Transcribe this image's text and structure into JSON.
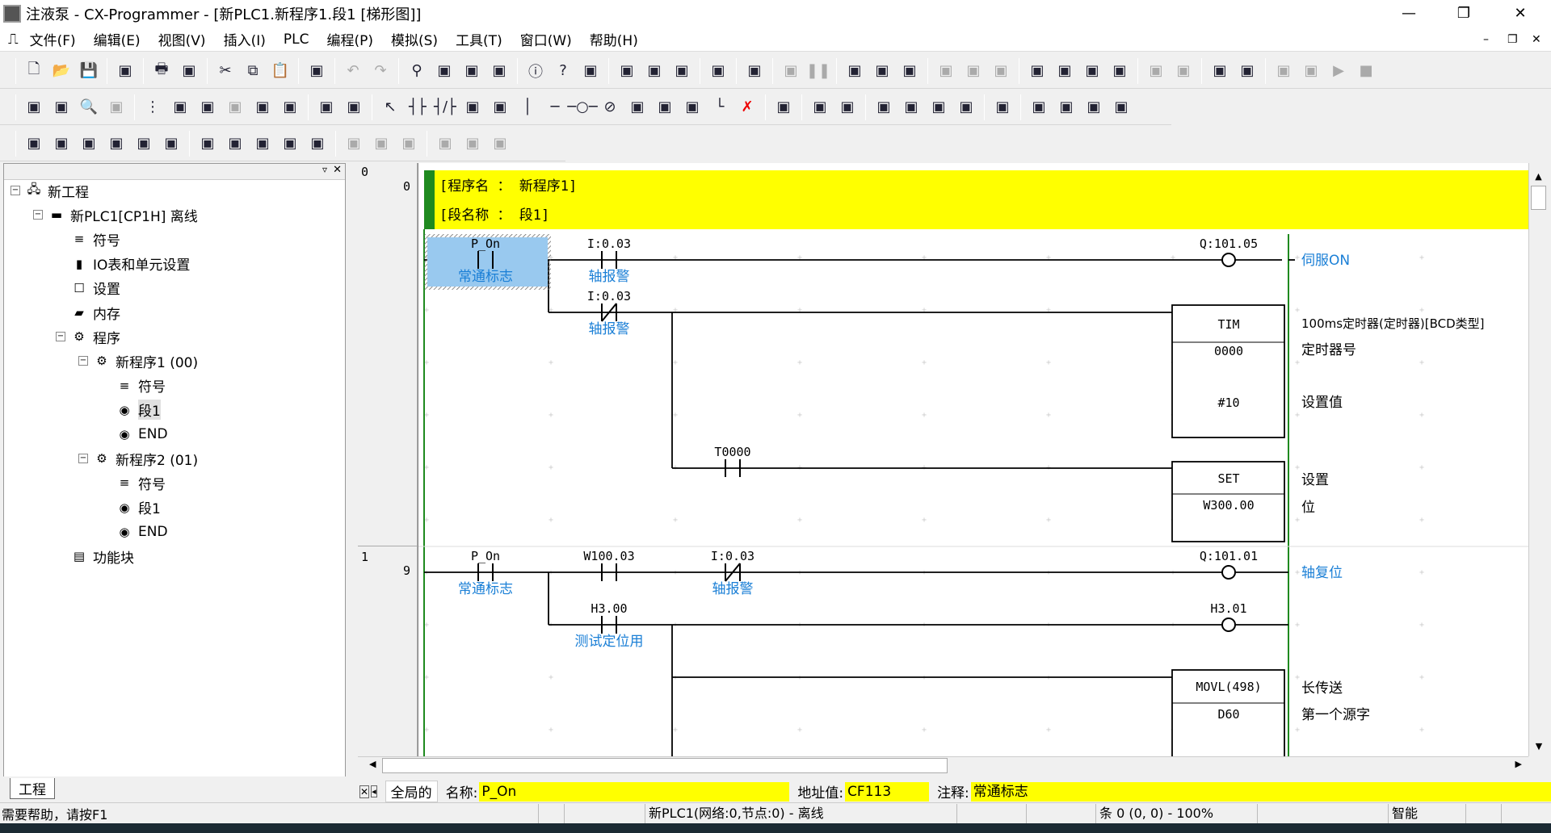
{
  "window": {
    "title": "注液泵 - CX-Programmer - [新PLC1.新程序1.段1 [梯形图]]",
    "minimize": "—",
    "restore": "❐",
    "close": "✕"
  },
  "menu": [
    "文件(F)",
    "编辑(E)",
    "视图(V)",
    "插入(I)",
    "PLC",
    "编程(P)",
    "模拟(S)",
    "工具(T)",
    "窗口(W)",
    "帮助(H)"
  ],
  "mdi_controls": [
    "–",
    "❐",
    "✕"
  ],
  "toolbars": {
    "row1": [
      "new-icon",
      "open-icon",
      "save-icon",
      "|",
      "print-preview-icon",
      "|",
      "print-icon",
      "preview-icon",
      "|",
      "cut-icon",
      "copy-icon",
      "paste-icon",
      "|",
      "paste-special-icon",
      "|",
      "undo-icon",
      "redo-icon",
      "|",
      "find-icon",
      "replace-icon",
      "cross-ref-icon",
      "address-ref-icon",
      "|",
      "info-icon",
      "help-icon",
      "context-help-icon",
      "|",
      "online-icon",
      "monitor-icon",
      "transfer-icon",
      "|",
      "compile-icon",
      "|",
      "compare-icon",
      "|",
      "step-icon",
      "pause-icon",
      "|",
      "io-table-icon",
      "setup-icon",
      "memory-icon",
      "|",
      "force-icon",
      "force-off-icon",
      "force-cancel-icon",
      "|",
      "set-icon",
      "reset-icon",
      "data-trace-icon",
      "time-chart-icon",
      "|",
      "sim-icon",
      "sim2-icon",
      "|",
      "view1-icon",
      "view2-icon",
      "|",
      "run-sim-icon",
      "pause-sim-icon",
      "run-icon",
      "stop-icon"
    ],
    "row2": [
      "zoom-in-icon",
      "zoom-fit-icon",
      "zoom-icon",
      "zoom-out-icon",
      "|",
      "grid-icon",
      "comment-icon",
      "list-icon",
      "rung-icon",
      "bus-icon",
      "tree-icon",
      "|",
      "sma-icon",
      "ct-icon",
      "|",
      "select-icon",
      "no-contact-icon",
      "nc-contact-icon",
      "or-no-icon",
      "or-nc-icon",
      "vline-icon",
      "hline-icon",
      "coil-icon",
      "nc-coil-icon",
      "instruction-icon",
      "block-icon",
      "pb-icon",
      "corner-icon",
      "delete-icon",
      "|",
      "online-edit-icon",
      "|",
      "transfer-to-plc-icon",
      "memory-card-icon",
      "|",
      "diff-up-icon",
      "diff-down-icon",
      "check-icon",
      "cancel-icon",
      "|",
      "window-icon",
      "|",
      "monitor-view-icon",
      "m2-icon",
      "m3-icon",
      "m4-icon"
    ],
    "row3": [
      "project-workspace-icon",
      "output-window-icon",
      "watch-window-icon",
      "address-ref-window-icon",
      "properties-icon",
      "symbol-table-icon",
      "|",
      "cross-ref-icon",
      "symbol-icon",
      "ladder-icon",
      "mnemonic-icon",
      "io-comment-icon",
      "|",
      "bit10-icon",
      "bit10b-icon",
      "bit16-icon",
      "|",
      "upload-icon",
      "download-icon",
      "compare-plc-icon"
    ]
  },
  "tree": {
    "items": [
      {
        "label": "新工程",
        "level": 0,
        "expander": "⊟",
        "icon": "network-icon"
      },
      {
        "label": "新PLC1[CP1H] 离线",
        "level": 1,
        "expander": "⊟",
        "icon": "plc-icon"
      },
      {
        "label": "符号",
        "level": 2,
        "icon": "symbol-icon"
      },
      {
        "label": "IO表和单元设置",
        "level": 2,
        "icon": "io-table-icon"
      },
      {
        "label": "设置",
        "level": 2,
        "icon": "settings-icon"
      },
      {
        "label": "内存",
        "level": 2,
        "icon": "memory-icon"
      },
      {
        "label": "程序",
        "level": 2,
        "expander": "⊟",
        "icon": "programs-icon"
      },
      {
        "label": "新程序1 (00)",
        "level": 3,
        "expander": "⊟",
        "icon": "program-icon"
      },
      {
        "label": "符号",
        "level": 4,
        "icon": "symbol-icon"
      },
      {
        "label": "段1",
        "level": 4,
        "icon": "section-icon",
        "selected": true
      },
      {
        "label": "END",
        "level": 4,
        "icon": "section-icon"
      },
      {
        "label": "新程序2 (01)",
        "level": 3,
        "expander": "⊟",
        "icon": "program-icon"
      },
      {
        "label": "符号",
        "level": 4,
        "icon": "symbol-icon"
      },
      {
        "label": "段1",
        "level": 4,
        "icon": "section-icon"
      },
      {
        "label": "END",
        "level": 4,
        "icon": "section-icon"
      },
      {
        "label": "功能块",
        "level": 2,
        "icon": "function-block-icon"
      }
    ],
    "tab": "工程"
  },
  "ladder": {
    "rung_numbers": [
      {
        "rung": "0",
        "step": "0"
      },
      {
        "rung": "1",
        "step": "9"
      }
    ],
    "header": {
      "program_name": "[程序名 ： 新程序1]",
      "section_name": "[段名称 ： 段1]"
    },
    "rung0": {
      "c1": {
        "addr": "P_On",
        "comment": "常通标志"
      },
      "c2": {
        "addr": "I:0.03",
        "comment": "轴报警"
      },
      "c3": {
        "addr": "I:0.03",
        "comment": "轴报警"
      },
      "c4": {
        "addr": "T0000"
      },
      "coil": {
        "addr": "Q:101.05",
        "comment": "伺服ON"
      },
      "tim": {
        "name": "TIM",
        "op1": "0000",
        "op2": "#10",
        "comment": "100ms定时器(定时器)[BCD类型]",
        "op1_comment": "定时器号",
        "op2_comment": "设置值"
      },
      "set": {
        "name": "SET",
        "op1": "W300.00",
        "comment": "设置",
        "op1_comment": "位"
      }
    },
    "rung1": {
      "c1": {
        "addr": "P_On",
        "comment": "常通标志"
      },
      "c2": {
        "addr": "W100.03"
      },
      "c3": {
        "addr": "I:0.03",
        "comment": "轴报警"
      },
      "c4": {
        "addr": "H3.00",
        "comment": "测试定位用"
      },
      "coil": {
        "addr": "Q:101.01",
        "comment": "轴复位"
      },
      "coil2": {
        "addr": "H3.01"
      },
      "movl": {
        "name": "MOVL(498)",
        "op1": "D60",
        "comment": "长传送",
        "op1_comment": "第一个源字"
      }
    }
  },
  "infobar": {
    "scope": "全局的",
    "name_label": "名称:",
    "name_value": "P_On",
    "address_label": "地址值:",
    "address_value": "CF113",
    "comment_label": "注释:",
    "comment_value": "常通标志"
  },
  "statusbar": {
    "help": "需要帮助，请按F1",
    "plc_status": "新PLC1(网络:0,节点:0) - 离线",
    "position": "条 0 (0, 0) - 100%",
    "mode": "智能"
  },
  "colors": {
    "header_yellow": "#ffff00",
    "selection": "#99c9ef",
    "comment_blue": "#1a7fd6",
    "rail_green": "#1f8a1f"
  }
}
